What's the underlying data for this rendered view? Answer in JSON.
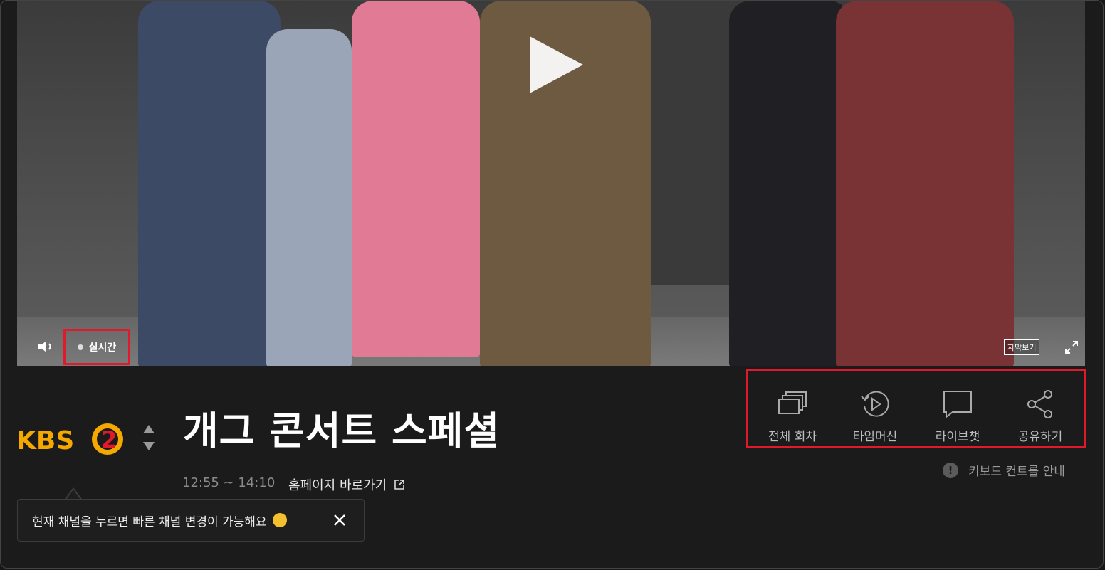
{
  "video": {
    "live_label": "실시간",
    "subtitle_label": "자막보기"
  },
  "channel": {
    "logo_text": "KBS",
    "logo_number": "2",
    "logo_color": "#f5a800"
  },
  "program": {
    "title": "개그 콘서트 스페셜",
    "time": "12:55 ~ 14:10",
    "homepage_label": "홈페이지 바로가기"
  },
  "actions": [
    {
      "label": "전체 회차",
      "icon": "episodes-icon"
    },
    {
      "label": "타임머신",
      "icon": "timemachine-icon"
    },
    {
      "label": "라이브챗",
      "icon": "chat-icon"
    },
    {
      "label": "공유하기",
      "icon": "share-icon"
    }
  ],
  "keyboard_help": "키보드 컨트롤 안내",
  "tooltip": {
    "text": "현재 채널을 누르면 빠른 채널 변경이 가능해요"
  },
  "colors": {
    "highlight": "#e0192b",
    "background": "#1b1b1b"
  }
}
